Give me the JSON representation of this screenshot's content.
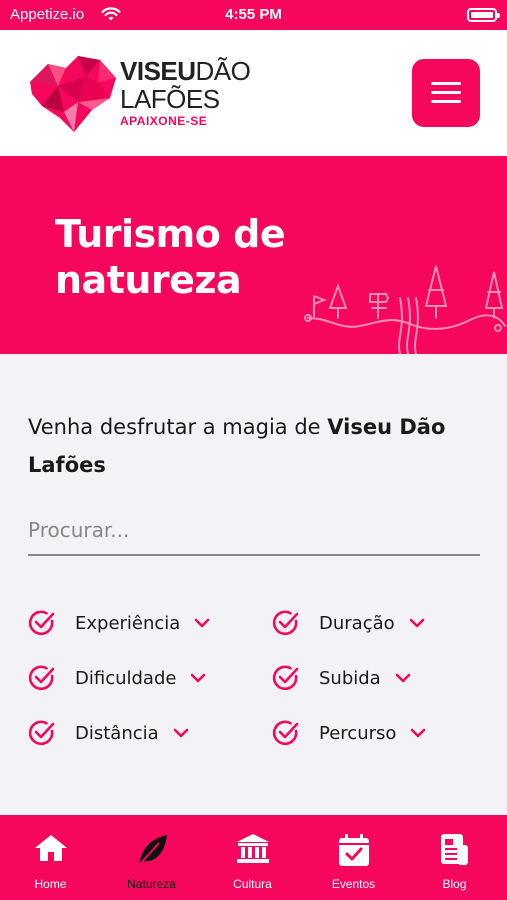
{
  "status_bar": {
    "carrier": "Appetize.io",
    "time": "4:55 PM"
  },
  "header": {
    "logo": {
      "line1_bold": "VISEU",
      "line1_thin": "DÃO",
      "line2": "LAFÕES",
      "tagline": "APAIXONE-SE"
    }
  },
  "hero": {
    "title": "Turismo de natureza"
  },
  "content": {
    "intro_prefix": "Venha desfrutar a magia de ",
    "intro_bold": "Viseu Dão Lafões",
    "search_placeholder": "Procurar...",
    "filters": [
      {
        "label": "Experiência"
      },
      {
        "label": "Duração"
      },
      {
        "label": "Dificuldade"
      },
      {
        "label": "Subida"
      },
      {
        "label": "Distância"
      },
      {
        "label": "Percurso"
      }
    ]
  },
  "bottom_nav": [
    {
      "label": "Home",
      "icon": "home-icon"
    },
    {
      "label": "Natureza",
      "icon": "leaf-icon",
      "active": true
    },
    {
      "label": "Cultura",
      "icon": "museum-icon"
    },
    {
      "label": "Eventos",
      "icon": "calendar-check-icon"
    },
    {
      "label": "Blog",
      "icon": "blog-icon"
    }
  ],
  "colors": {
    "accent": "#f7065e",
    "background": "#f3f3f7",
    "text": "#1a1a1a"
  }
}
